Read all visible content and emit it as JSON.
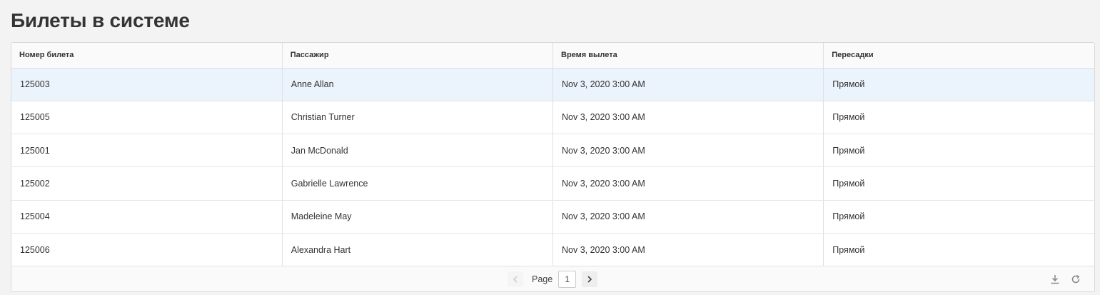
{
  "page": {
    "title": "Билеты в системе"
  },
  "table": {
    "columns": [
      "Номер билета",
      "Пассажир",
      "Время вылета",
      "Пересадки"
    ],
    "rows": [
      [
        "125003",
        "Anne Allan",
        "Nov 3, 2020 3:00 AM",
        "Прямой"
      ],
      [
        "125005",
        "Christian Turner",
        "Nov 3, 2020 3:00 AM",
        "Прямой"
      ],
      [
        "125001",
        "Jan McDonald",
        "Nov 3, 2020 3:00 AM",
        "Прямой"
      ],
      [
        "125002",
        "Gabrielle Lawrence",
        "Nov 3, 2020 3:00 AM",
        "Прямой"
      ],
      [
        "125004",
        "Madeleine May",
        "Nov 3, 2020 3:00 AM",
        "Прямой"
      ],
      [
        "125006",
        "Alexandra Hart",
        "Nov 3, 2020 3:00 AM",
        "Прямой"
      ]
    ],
    "selected_row": 0
  },
  "pagination": {
    "label": "Page",
    "current_page": "1",
    "prev_icon": "chevron-left-icon",
    "next_icon": "chevron-right-icon"
  },
  "toolbar": {
    "export_icon": "download-icon",
    "refresh_icon": "refresh-icon"
  },
  "colors": {
    "selected_row": "#ebf3fd",
    "header_bg": "#fafafa",
    "page_bg": "#f3f3f3"
  }
}
